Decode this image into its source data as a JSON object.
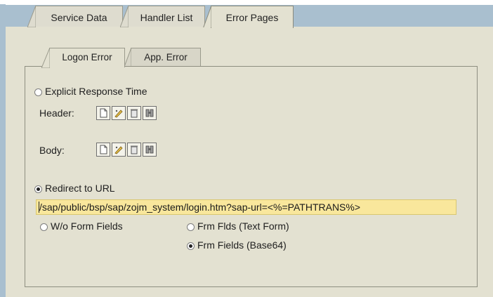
{
  "tabs": [
    {
      "label": "Service Data",
      "active": false
    },
    {
      "label": "Handler List",
      "active": false
    },
    {
      "label": "Error Pages",
      "active": true
    }
  ],
  "subtabs": [
    {
      "label": "Logon Error",
      "active": true
    },
    {
      "label": "App. Error",
      "active": false
    }
  ],
  "explicit_response": {
    "label": "Explicit Response Time",
    "checked": false,
    "header_label": "Header:",
    "body_label": "Body:",
    "icons": [
      "create-document-icon",
      "edit-pencil-icon",
      "delete-trash-icon",
      "binoculars-find-icon"
    ]
  },
  "redirect": {
    "label": "Redirect to URL",
    "checked": true,
    "url_value": "/sap/public/bsp/sap/zojm_system/login.htm?sap-url=<%=PATHTRANS%>",
    "options": [
      {
        "label": "W/o Form Fields",
        "checked": false
      },
      {
        "label": "Frm Flds (Text Form)",
        "checked": false
      },
      {
        "label": "Frm Fields (Base64)",
        "checked": true
      }
    ]
  },
  "colors": {
    "header_bar": "#a9bfcf",
    "panel_bg": "#e3e1d1",
    "url_field_bg": "#f9e79c"
  }
}
